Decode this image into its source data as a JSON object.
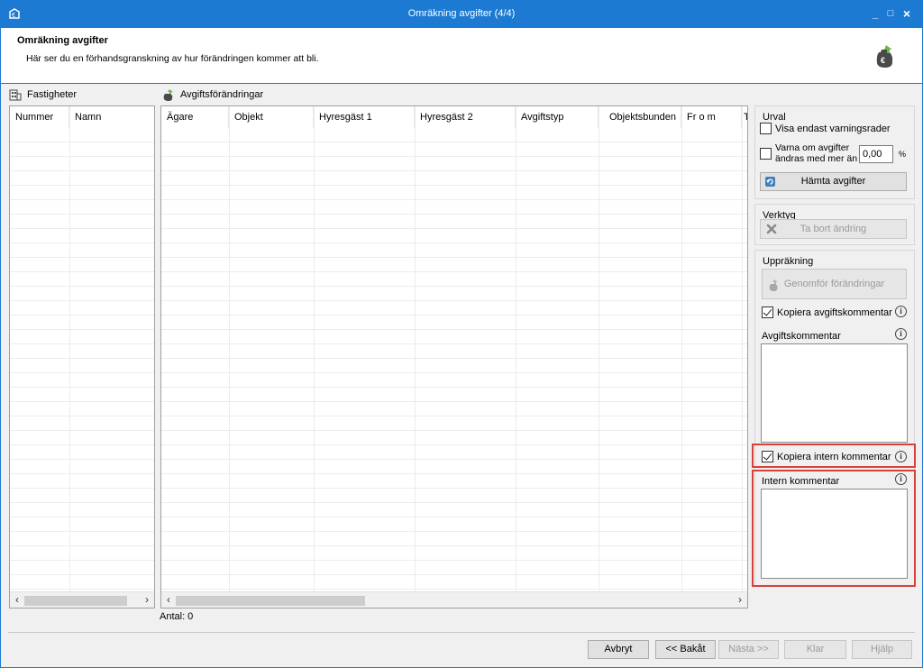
{
  "window": {
    "title": "Omräkning avgifter (4/4)",
    "controls": [
      "_",
      "□",
      "×"
    ]
  },
  "header": {
    "title": "Omräkning avgifter",
    "subtitle": "Här ser du en förhandsgranskning av hur förändringen kommer att bli."
  },
  "fastigheter": {
    "label": "Fastigheter",
    "columns": [
      "Nummer",
      "Namn"
    ]
  },
  "avgifts": {
    "label": "Avgiftsförändringar",
    "columns": [
      "Ägare",
      "Objekt",
      "Hyresgäst 1",
      "Hyresgäst 2",
      "Avgiftstyp",
      "Objektsbunden",
      "Fr o m",
      "T"
    ]
  },
  "antal": "Antal: 0",
  "urval": {
    "label": "Urval",
    "visa_label": "Visa endast varningsrader",
    "varna_line1": "Varna om avgifter",
    "varna_line2": "ändras med mer än",
    "percent_value": "0,00",
    "percent_sign": "%",
    "hamta_label": "Hämta avgifter"
  },
  "verktyg": {
    "label": "Verktyg",
    "ta_bort_label": "Ta bort ändring"
  },
  "upprakning": {
    "label": "Uppräkning",
    "genomfor_label": "Genomför förändringar",
    "kopiera_avgift_label": "Kopiera avgiftskommentar",
    "avgiftskommentar_label": "Avgiftskommentar",
    "kopiera_intern_label": "Kopiera intern kommentar",
    "intern_label": "Intern kommentar"
  },
  "footer": {
    "avbryt": "Avbryt",
    "bakat": "<< Bakåt",
    "nasta": "Nästa >>",
    "klar": "Klar",
    "hjalp": "Hjälp"
  },
  "colors": {
    "titlebar": "#1c7ad2",
    "highlight": "#d9423b"
  }
}
